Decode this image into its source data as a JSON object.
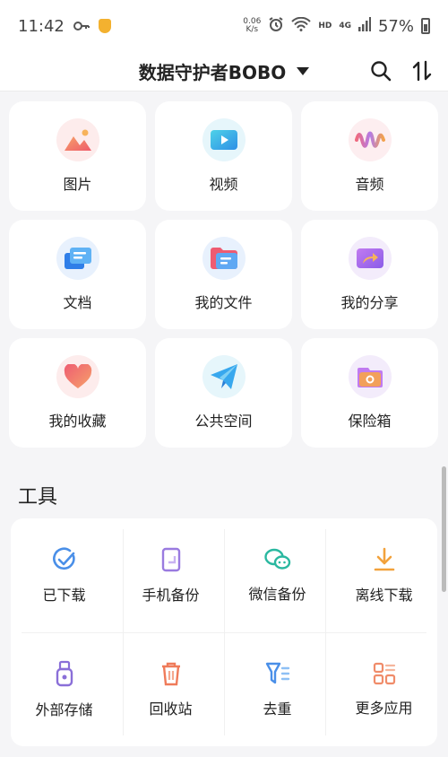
{
  "status_bar": {
    "time": "11:42",
    "net_speed_value": "0.06",
    "net_speed_unit": "K/s",
    "hd_tag": "HD",
    "signal_tag": "4G",
    "battery_percent": "57%"
  },
  "header": {
    "title": "数据守护者BOBO"
  },
  "categories": [
    {
      "label": "图片",
      "icon": "picture-icon",
      "bg": "#fdecec"
    },
    {
      "label": "视频",
      "icon": "video-icon",
      "bg": "#e6f6fb"
    },
    {
      "label": "音频",
      "icon": "audio-icon",
      "bg": "#fdeef0"
    },
    {
      "label": "文档",
      "icon": "document-icon",
      "bg": "#e8f1fd"
    },
    {
      "label": "我的文件",
      "icon": "folder-icon",
      "bg": "#e8f1fd"
    },
    {
      "label": "我的分享",
      "icon": "share-icon",
      "bg": "#f3ecfb"
    },
    {
      "label": "我的收藏",
      "icon": "heart-icon",
      "bg": "#fdecec"
    },
    {
      "label": "公共空间",
      "icon": "paper-plane-icon",
      "bg": "#e6f6fb"
    },
    {
      "label": "保险箱",
      "icon": "safe-box-icon",
      "bg": "#f3ecfb"
    }
  ],
  "tools_section": {
    "title": "工具",
    "items": [
      {
        "label": "已下载",
        "icon": "downloaded-check-icon",
        "color": "#4a8fe8"
      },
      {
        "label": "手机备份",
        "icon": "phone-backup-icon",
        "color": "#9a7be0"
      },
      {
        "label": "微信备份",
        "icon": "wechat-icon",
        "color": "#2ab8a0"
      },
      {
        "label": "离线下载",
        "icon": "offline-download-icon",
        "color": "#f2a23c"
      },
      {
        "label": "外部存储",
        "icon": "usb-storage-icon",
        "color": "#8a6fd8"
      },
      {
        "label": "回收站",
        "icon": "recycle-bin-icon",
        "color": "#ef7b5a"
      },
      {
        "label": "去重",
        "icon": "dedupe-icon",
        "color": "#4a8fe8"
      },
      {
        "label": "更多应用",
        "icon": "more-apps-icon",
        "color": "#f08c6a"
      }
    ]
  }
}
